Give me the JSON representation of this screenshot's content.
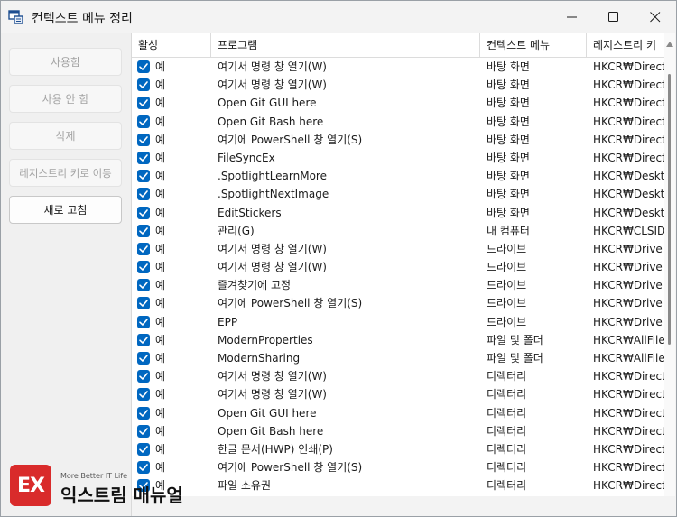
{
  "window": {
    "title": "컨텍스트 메뉴 정리",
    "icons": {
      "app": "context-menu-app-icon",
      "minimize": "minimize-icon",
      "maximize": "maximize-icon",
      "close": "close-icon"
    }
  },
  "sidebar": {
    "buttons": [
      {
        "label": "사용함",
        "enabled": false
      },
      {
        "label": "사용 안 함",
        "enabled": false
      },
      {
        "label": "삭제",
        "enabled": false
      },
      {
        "label": "레지스트리 키로 이동",
        "enabled": false
      },
      {
        "label": "새로 고침",
        "enabled": true
      }
    ]
  },
  "table": {
    "columns": [
      "활성",
      "프로그램",
      "컨텍스트 메뉴",
      "레지스트리 키"
    ],
    "rows": [
      {
        "active": "예",
        "program": "여기서 명령 창 열기(W)",
        "menu": "바탕 화면",
        "key": "HKCR₩Directory"
      },
      {
        "active": "예",
        "program": "여기서 명령 창 열기(W)",
        "menu": "바탕 화면",
        "key": "HKCR₩Directory"
      },
      {
        "active": "예",
        "program": "Open Git GUI here",
        "menu": "바탕 화면",
        "key": "HKCR₩Directory"
      },
      {
        "active": "예",
        "program": "Open Git Bash here",
        "menu": "바탕 화면",
        "key": "HKCR₩Directory"
      },
      {
        "active": "예",
        "program": "여기에 PowerShell 창 열기(S)",
        "menu": "바탕 화면",
        "key": "HKCR₩Directory"
      },
      {
        "active": "예",
        "program": " FileSyncEx",
        "menu": "바탕 화면",
        "key": "HKCR₩Directory"
      },
      {
        "active": "예",
        "program": ".SpotlightLearnMore",
        "menu": "바탕 화면",
        "key": "HKCR₩Desktop"
      },
      {
        "active": "예",
        "program": ".SpotlightNextImage",
        "menu": "바탕 화면",
        "key": "HKCR₩Desktop"
      },
      {
        "active": "예",
        "program": "EditStickers",
        "menu": "바탕 화면",
        "key": "HKCR₩Desktop"
      },
      {
        "active": "예",
        "program": "관리(G)",
        "menu": "내 컴퓨터",
        "key": "HKCR₩CLSID"
      },
      {
        "active": "예",
        "program": "여기서 명령 창 열기(W)",
        "menu": "드라이브",
        "key": "HKCR₩Drive"
      },
      {
        "active": "예",
        "program": "여기서 명령 창 열기(W)",
        "menu": "드라이브",
        "key": "HKCR₩Drive"
      },
      {
        "active": "예",
        "program": "즐겨찾기에 고정",
        "menu": "드라이브",
        "key": "HKCR₩Drive"
      },
      {
        "active": "예",
        "program": "여기에 PowerShell 창 열기(S)",
        "menu": "드라이브",
        "key": "HKCR₩Drive"
      },
      {
        "active": "예",
        "program": "EPP",
        "menu": "드라이브",
        "key": "HKCR₩Drive"
      },
      {
        "active": "예",
        "program": "ModernProperties",
        "menu": "파일 및 폴더",
        "key": "HKCR₩AllFile"
      },
      {
        "active": "예",
        "program": "ModernSharing",
        "menu": "파일 및 폴더",
        "key": "HKCR₩AllFile"
      },
      {
        "active": "예",
        "program": "여기서 명령 창 열기(W)",
        "menu": "디렉터리",
        "key": "HKCR₩Directory"
      },
      {
        "active": "예",
        "program": "여기서 명령 창 열기(W)",
        "menu": "디렉터리",
        "key": "HKCR₩Directory"
      },
      {
        "active": "예",
        "program": "Open Git GUI here",
        "menu": "디렉터리",
        "key": "HKCR₩Directory"
      },
      {
        "active": "예",
        "program": "Open Git Bash here",
        "menu": "디렉터리",
        "key": "HKCR₩Directory"
      },
      {
        "active": "예",
        "program": "한글 문서(HWP) 인쇄(P)",
        "menu": "디렉터리",
        "key": "HKCR₩Directory"
      },
      {
        "active": "예",
        "program": "여기에 PowerShell 창 열기(S)",
        "menu": "디렉터리",
        "key": "HKCR₩Directory"
      },
      {
        "active": "예",
        "program": "파일 소유권",
        "menu": "디렉터리",
        "key": "HKCR₩Directory"
      }
    ]
  },
  "watermark": {
    "logo_text": "EX",
    "subtitle": "More Better IT Life",
    "name": "익스트림 매뉴얼"
  },
  "colors": {
    "accent": "#0067c0",
    "watermark_red": "#d92b2b"
  }
}
